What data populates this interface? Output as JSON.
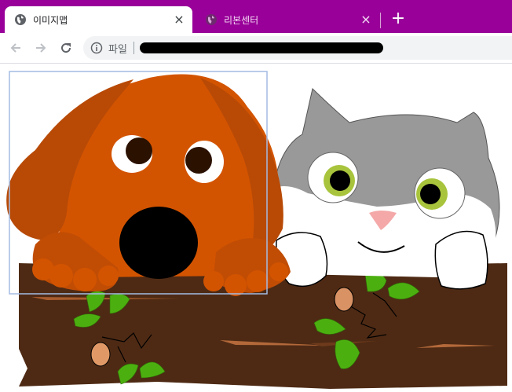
{
  "browser": {
    "active_tab": {
      "title": "이미지맵",
      "close_label": "×",
      "favicon": "globe-icon"
    },
    "inactive_tab": {
      "title": "리본센터",
      "close_label": "×",
      "favicon": "globe-icon"
    },
    "new_tab_label": "+",
    "toolbar": {
      "back_icon": "arrow-left-icon",
      "forward_icon": "arrow-right-icon",
      "reload_icon": "reload-icon",
      "address": {
        "scheme_label": "파일",
        "info_icon": "info-icon",
        "url_redacted": true
      }
    },
    "colors": {
      "tabstrip": "#990099",
      "toolbar": "#ffffff",
      "omnibox": "#f1f3f4"
    }
  },
  "content": {
    "image": "dog-and-cat-on-log-illustration",
    "image_map_highlight": {
      "shape": "rect",
      "target": "dog"
    },
    "colors": {
      "dog": "#d35400",
      "dog_ear": "#b84a06",
      "cat_gray": "#999999",
      "cat_white": "#ffffff",
      "log": "#4e2a14",
      "leaf": "#4caf10",
      "highlight_border": "#a4bce4"
    }
  }
}
